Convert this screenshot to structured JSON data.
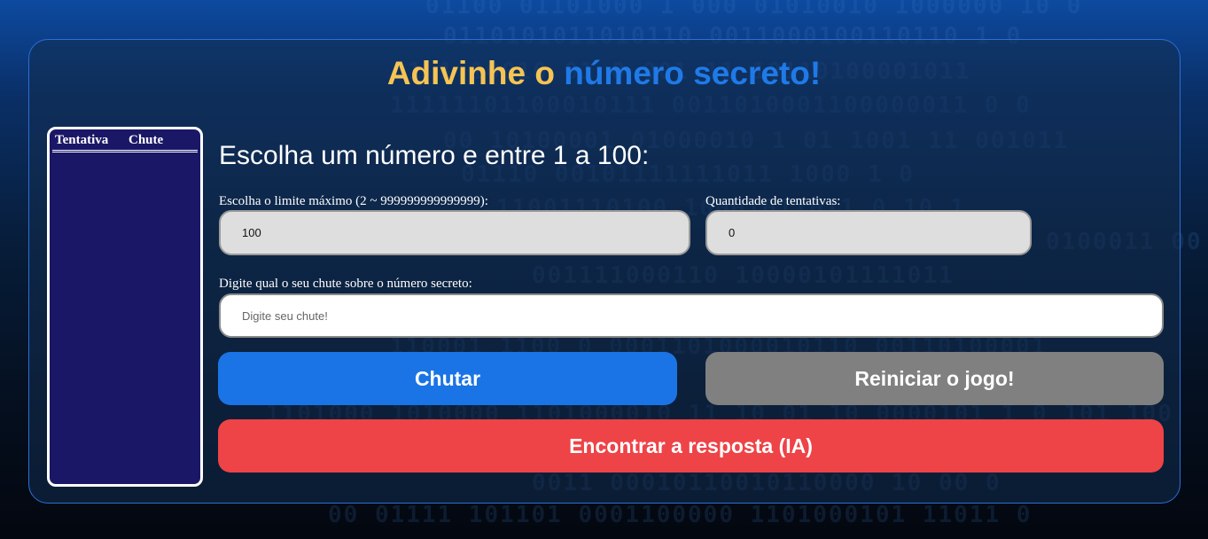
{
  "title": {
    "part1": "Adivinhe o",
    "part2": "número secreto!"
  },
  "history": {
    "col_attempt": "Tentativa",
    "col_guess": "Chute"
  },
  "subtitle": "Escolha um número e entre 1 a 100:",
  "max_limit": {
    "label": "Escolha o limite máximo (2 ~ 999999999999999):",
    "value": "100"
  },
  "attempts": {
    "label": "Quantidade de tentativas:",
    "value": "0"
  },
  "guess": {
    "label": "Digite qual o seu chute sobre o número secreto:",
    "placeholder": "Digite seu chute!"
  },
  "buttons": {
    "guess": "Chutar",
    "restart": "Reiniciar o jogo!",
    "ai": "Encontrar a resposta (IA)"
  },
  "colors": {
    "title_yellow": "#f6c453",
    "title_blue": "#1f7ae8",
    "guess_button": "#1a74e5",
    "restart_button": "#808080",
    "ai_button": "#ee4347",
    "history_bg": "#1b1767"
  }
}
